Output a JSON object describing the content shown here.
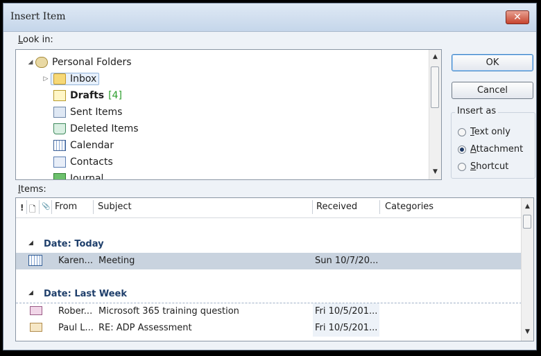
{
  "window": {
    "title": "Insert Item",
    "close_glyph": "✕"
  },
  "look_in": {
    "label_prefix": "L",
    "label_rest": "ook in:",
    "folders": [
      {
        "name": "Personal Folders",
        "icon": "personal-folders-icon",
        "expanded": true
      },
      {
        "name": "Inbox",
        "icon": "inbox-folder-icon",
        "selected": true
      },
      {
        "name": "Drafts",
        "count": "[4]",
        "icon": "drafts-folder-icon",
        "bold": true
      },
      {
        "name": "Sent Items",
        "icon": "sent-items-icon"
      },
      {
        "name": "Deleted Items",
        "icon": "deleted-items-icon"
      },
      {
        "name": "Calendar",
        "icon": "calendar-icon"
      },
      {
        "name": "Contacts",
        "icon": "contacts-icon"
      },
      {
        "name": "Journal",
        "icon": "journal-icon"
      }
    ]
  },
  "buttons": {
    "ok": "OK",
    "cancel": "Cancel"
  },
  "insert_as": {
    "legend": "Insert as",
    "options": [
      {
        "accel": "T",
        "rest": "ext only",
        "selected": false
      },
      {
        "accel": "A",
        "rest": "ttachment",
        "selected": true
      },
      {
        "accel": "S",
        "rest": "hortcut",
        "selected": false
      }
    ]
  },
  "items": {
    "label_prefix": "I",
    "label_rest": "tems:",
    "columns": {
      "importance": "!",
      "icon": "🗋",
      "attachment": "📎",
      "from": "From",
      "subject": "Subject",
      "received": "Received",
      "categories": "Categories"
    },
    "groups": [
      {
        "title": "Date: Today",
        "rows": [
          {
            "from": "Karen...",
            "subject": "Meeting",
            "received": "Sun 10/7/20...",
            "icon": "meeting-request-icon",
            "selected": true
          }
        ]
      },
      {
        "title": "Date: Last Week",
        "rows": [
          {
            "from": "Rober...",
            "subject": "Microsoft 365 training question",
            "received": "Fri 10/5/201...",
            "icon": "envelope-open-icon",
            "selected": false
          },
          {
            "from": "Paul L...",
            "subject": "RE: ADP Assessment",
            "received": "Fri 10/5/201...",
            "icon": "envelope-icon",
            "selected": false
          }
        ]
      }
    ]
  },
  "colors": {
    "selection": "#c9d3df",
    "group_header": "#1f3f6b",
    "draft_count": "#2c9e2c"
  }
}
